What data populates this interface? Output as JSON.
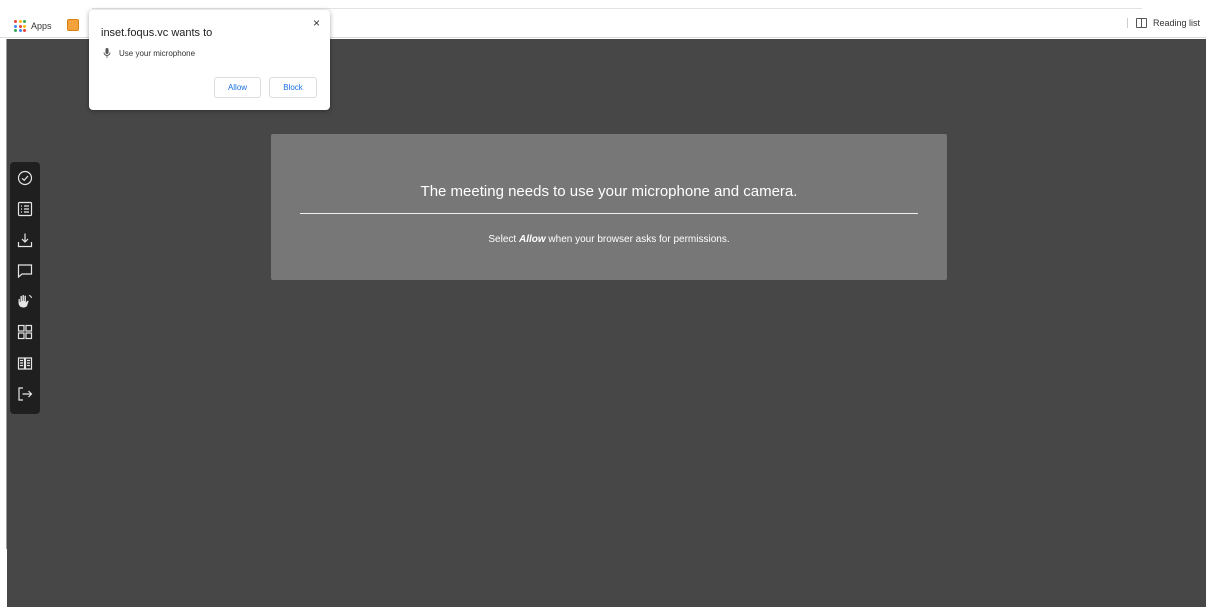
{
  "bookmarks_bar": {
    "apps_label": "Apps",
    "reading_list_label": "Reading list"
  },
  "meeting": {
    "notice_title": "The meeting needs to use your microphone and camera.",
    "notice_sub_prefix": "Select ",
    "notice_sub_emphasis": "Allow",
    "notice_sub_suffix": " when your browser asks for permissions."
  },
  "sidebar": {
    "tools": [
      {
        "icon": "check-circle-icon"
      },
      {
        "icon": "list-icon"
      },
      {
        "icon": "download-icon"
      },
      {
        "icon": "chat-icon"
      },
      {
        "icon": "raise-hand-icon"
      },
      {
        "icon": "grid-view-icon"
      },
      {
        "icon": "book-icon"
      },
      {
        "icon": "exit-icon"
      }
    ]
  },
  "permission_popup": {
    "title": "inset.foqus.vc wants to",
    "permission": "Use your microphone",
    "allow_label": "Allow",
    "block_label": "Block",
    "close_symbol": "×"
  },
  "colors": {
    "meeting_bg": "#474747",
    "notice_bg": "#777777",
    "sidebar_bg": "#1f1f1f",
    "link_blue": "#1a73e8"
  }
}
